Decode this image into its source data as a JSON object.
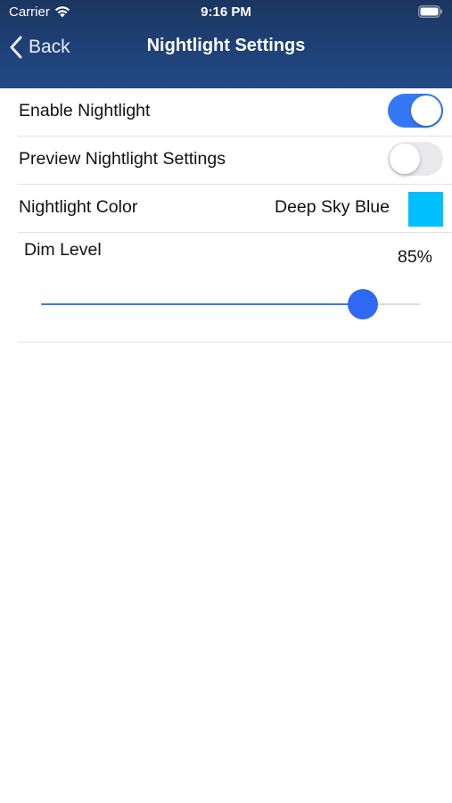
{
  "status_bar": {
    "carrier": "Carrier",
    "time": "9:16 PM",
    "wifi_icon": "wifi-icon",
    "battery_icon": "battery-icon"
  },
  "nav": {
    "back_label": "Back",
    "back_icon": "chevron-left-icon",
    "title": "Nightlight Settings"
  },
  "settings": {
    "enable_nightlight": {
      "label": "Enable Nightlight",
      "on": true
    },
    "preview_nightlight": {
      "label": "Preview Nightlight Settings",
      "on": false
    },
    "nightlight_color": {
      "label": "Nightlight Color",
      "value": "Deep Sky Blue",
      "swatch_color": "#00bfff"
    },
    "dim_level": {
      "label": "Dim Level",
      "value_text": "85%",
      "value": 0.85
    }
  },
  "colors": {
    "header_top": "#1b3560",
    "header_bottom": "#234a86",
    "accent": "#3478f6",
    "toggle_off": "#e9e9eb"
  }
}
